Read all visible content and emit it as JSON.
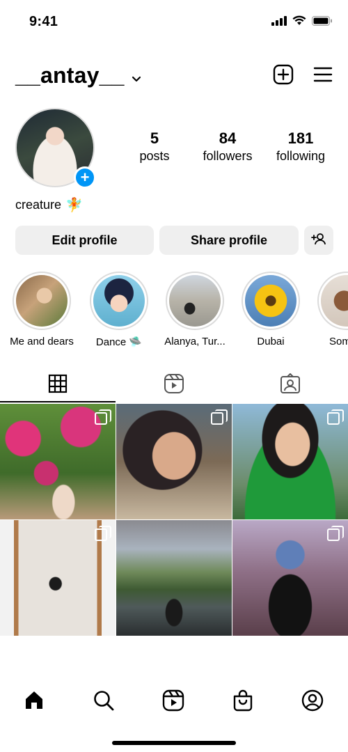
{
  "status_bar": {
    "time": "9:41"
  },
  "header": {
    "username": "__antay__"
  },
  "profile": {
    "posts": {
      "count": "5",
      "label": "posts"
    },
    "followers": {
      "count": "84",
      "label": "followers"
    },
    "following": {
      "count": "181",
      "label": "following"
    },
    "bio": "creature",
    "bio_emoji": "🧚"
  },
  "buttons": {
    "edit_label": "Edit profile",
    "share_label": "Share profile"
  },
  "highlights": [
    {
      "label": "Me and dears"
    },
    {
      "label": "Dance 🛸"
    },
    {
      "label": "Alanya, Tur..."
    },
    {
      "label": "Dubai"
    },
    {
      "label": "Somew"
    }
  ],
  "tabs": [
    {
      "icon": "grid-icon",
      "active": true
    },
    {
      "icon": "reels-icon",
      "active": false
    },
    {
      "icon": "tagged-icon",
      "active": false
    }
  ],
  "bottom_nav": [
    {
      "icon": "home-icon"
    },
    {
      "icon": "search-icon"
    },
    {
      "icon": "reels-icon"
    },
    {
      "icon": "shop-icon"
    },
    {
      "icon": "profile-icon"
    }
  ],
  "colors": {
    "accent": "#0095f6",
    "button_bg": "#efefef",
    "border": "#dbdbdb"
  }
}
